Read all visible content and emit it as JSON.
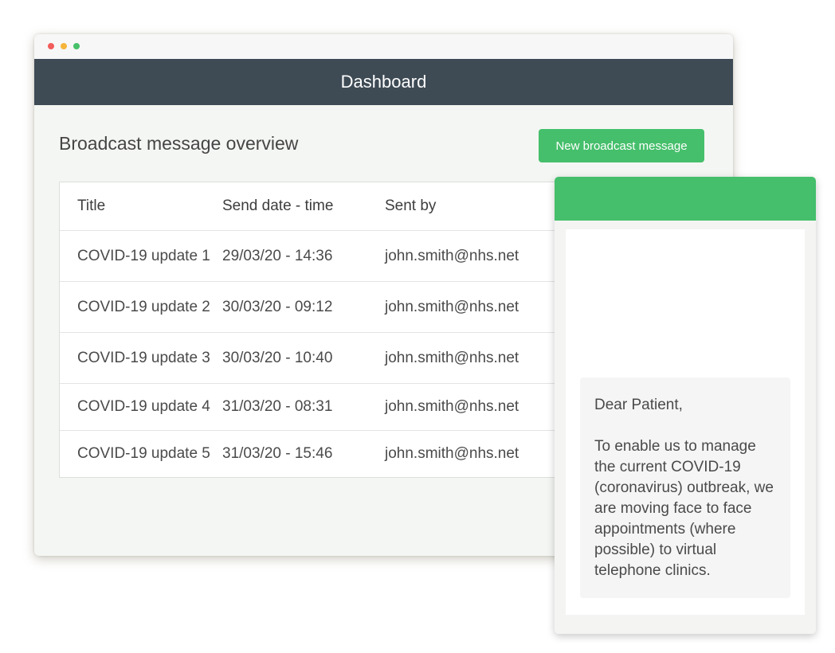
{
  "header": {
    "title": "Dashboard"
  },
  "page": {
    "title": "Broadcast message overview",
    "new_button_label": "New broadcast message"
  },
  "table": {
    "columns": [
      "Title",
      "Send date - time",
      "Sent by"
    ],
    "rows": [
      {
        "title": "COVID-19 update 1",
        "sent": "29/03/20 - 14:36",
        "by": "john.smith@nhs.net"
      },
      {
        "title": "COVID-19 update 2",
        "sent": "30/03/20 - 09:12",
        "by": "john.smith@nhs.net"
      },
      {
        "title": "COVID-19 update 3",
        "sent": "30/03/20 - 10:40",
        "by": "john.smith@nhs.net"
      },
      {
        "title": "COVID-19 update 4",
        "sent": "31/03/20 - 08:31",
        "by": "john.smith@nhs.net"
      },
      {
        "title": "COVID-19 update 5",
        "sent": "31/03/20 - 15:46",
        "by": "john.smith@nhs.net"
      }
    ]
  },
  "message_preview": {
    "greeting": "Dear Patient,",
    "body": "To enable us to manage the current COVID-19 (coronavirus) outbreak, we are moving face to face appointments (where possible) to virtual telephone clinics."
  },
  "colors": {
    "header_bg": "#3e4b55",
    "accent_green": "#45bf6b",
    "window_bg": "#f4f6f3"
  }
}
